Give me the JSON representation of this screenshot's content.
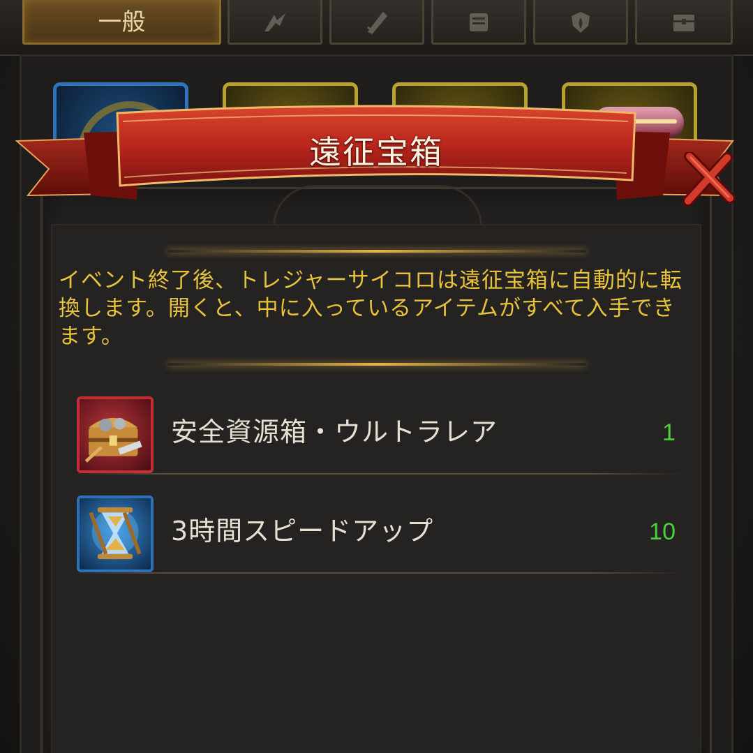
{
  "tabs": [
    {
      "label": "一般",
      "icon": "general-icon",
      "active": true
    },
    {
      "label": "",
      "icon": "combat-icon",
      "active": false
    },
    {
      "label": "",
      "icon": "sword-icon",
      "active": false
    },
    {
      "label": "",
      "icon": "scroll-icon",
      "active": false
    },
    {
      "label": "",
      "icon": "shield-icon",
      "active": false
    },
    {
      "label": "",
      "icon": "chest-icon",
      "active": false
    }
  ],
  "dialog": {
    "title": "遠征宝箱",
    "description": "イベント終了後、トレジャーサイコロは遠征宝箱に自動的に転換します。開くと、中に入っているアイテムがすべて入手できます。",
    "close_icon": "close-icon"
  },
  "items": [
    {
      "name": "安全資源箱・ウルトラレア",
      "quantity": "1",
      "icon": "resource-chest-icon"
    },
    {
      "name": "3時間スピードアップ",
      "quantity": "10",
      "icon": "hourglass-icon"
    }
  ],
  "colors": {
    "accent_gold": "#e8c23c",
    "quantity_green": "#49d23c",
    "ribbon_red": "#b8261d",
    "title_text": "#fbf2dd"
  }
}
